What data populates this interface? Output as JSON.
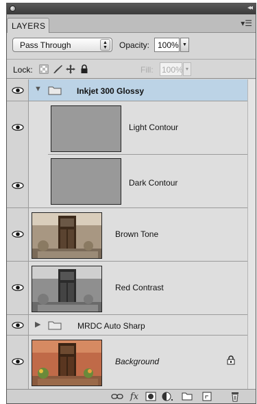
{
  "panel": {
    "tab_label": "LAYERS",
    "menu_icon": "panel-menu-icon",
    "collapse_icon": "collapse-arrows-icon"
  },
  "blend": {
    "mode": "Pass Through",
    "opacity_label": "Opacity:",
    "opacity_value": "100%"
  },
  "lock": {
    "label": "Lock:",
    "icons": [
      "lock-transparent-pixels-icon",
      "lock-image-pixels-icon",
      "lock-position-icon",
      "lock-all-icon"
    ],
    "fill_label": "Fill:",
    "fill_value": "100%"
  },
  "layers": [
    {
      "name": "Inkjet 300 Glossy",
      "type": "group",
      "expanded": true,
      "selected": true,
      "visible": true
    },
    {
      "name": "Light Contour",
      "type": "adjustment",
      "indented": true,
      "visible": true
    },
    {
      "name": "Dark Contour",
      "type": "adjustment",
      "indented": true,
      "visible": true
    },
    {
      "name": "Brown Tone",
      "type": "image",
      "tone": "sepia",
      "visible": true
    },
    {
      "name": "Red Contrast",
      "type": "image",
      "tone": "gray",
      "visible": true
    },
    {
      "name": "MRDC Auto Sharp",
      "type": "group",
      "expanded": false,
      "visible": true
    },
    {
      "name": "Background",
      "type": "image",
      "tone": "color",
      "italic": true,
      "locked": true,
      "visible": true
    }
  ],
  "bottom_icons": [
    "link-layers-icon",
    "layer-style-fx-icon",
    "layer-mask-icon",
    "adjustment-layer-icon",
    "new-group-icon",
    "new-layer-icon",
    "trash-icon"
  ],
  "colors": {
    "selected_row": "#bcd3e6",
    "panel_bg": "#d6d6d6"
  }
}
